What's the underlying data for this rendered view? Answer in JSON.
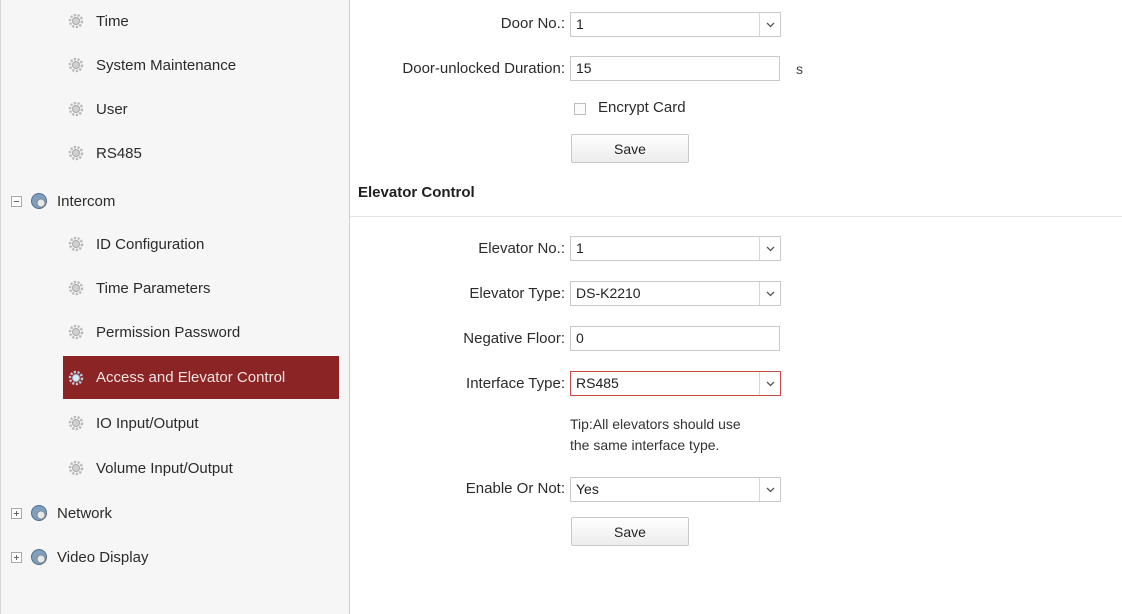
{
  "sidebar": {
    "items": [
      {
        "label": "Time",
        "kind": "child"
      },
      {
        "label": "System Maintenance",
        "kind": "child"
      },
      {
        "label": "User",
        "kind": "child"
      },
      {
        "label": "RS485",
        "kind": "child"
      },
      {
        "label": "Intercom",
        "kind": "parent",
        "state": "expanded"
      },
      {
        "label": "ID Configuration",
        "kind": "child"
      },
      {
        "label": "Time Parameters",
        "kind": "child"
      },
      {
        "label": "Permission Password",
        "kind": "child"
      },
      {
        "label": "Access and Elevator Control",
        "kind": "child",
        "active": true
      },
      {
        "label": "IO Input/Output",
        "kind": "child"
      },
      {
        "label": "Volume Input/Output",
        "kind": "child"
      },
      {
        "label": "Network",
        "kind": "parent",
        "state": "collapsed"
      },
      {
        "label": "Video Display",
        "kind": "parent",
        "state": "collapsed"
      }
    ],
    "icons": {
      "child": "gear-icon",
      "parent": "globe-icon"
    }
  },
  "door": {
    "door_no_label": "Door No.:",
    "door_no_value": "1",
    "duration_label": "Door-unlocked Duration:",
    "duration_value": "15",
    "duration_unit": "s",
    "encrypt_label": "Encrypt Card",
    "encrypt_checked": false,
    "save_label": "Save"
  },
  "elevator": {
    "section_title": "Elevator Control",
    "elevator_no_label": "Elevator No.:",
    "elevator_no_value": "1",
    "type_label": "Elevator Type:",
    "type_value": "DS-K2210",
    "negative_floor_label": "Negative Floor:",
    "negative_floor_value": "0",
    "interface_label": "Interface Type:",
    "interface_value": "RS485",
    "tip_line1": "Tip:All elevators should use",
    "tip_line2": "the same interface type.",
    "enable_label": "Enable Or Not:",
    "enable_value": "Yes",
    "save_label": "Save"
  },
  "colors": {
    "active_bg": "#8b2424",
    "active_text": "#f3e3e3",
    "highlight_border": "#c84c4c"
  }
}
